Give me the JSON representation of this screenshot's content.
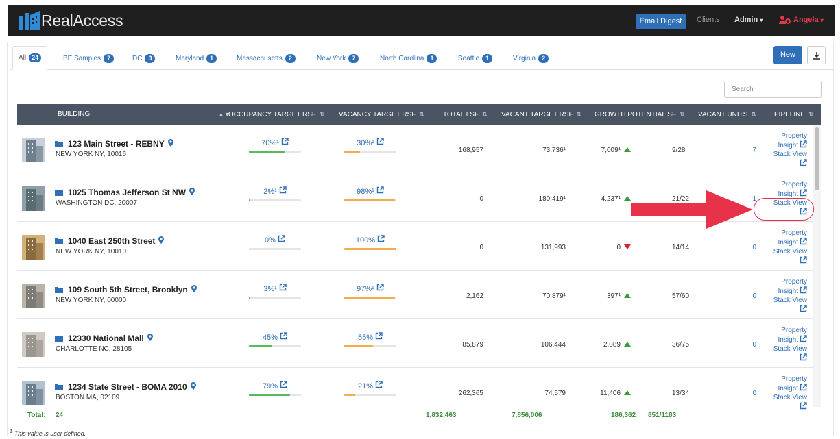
{
  "app": {
    "brand": "RealAccess",
    "nav": {
      "email_digest": "Email Digest",
      "clients": "Clients",
      "admin": "Admin",
      "user": "Angela"
    }
  },
  "tabs": [
    {
      "label": "All",
      "count": "24"
    },
    {
      "label": "BE Samples",
      "count": "7"
    },
    {
      "label": "DC",
      "count": "3"
    },
    {
      "label": "Maryland",
      "count": "1"
    },
    {
      "label": "Massachusetts",
      "count": "2"
    },
    {
      "label": "New York",
      "count": "7"
    },
    {
      "label": "North Carolina",
      "count": "1"
    },
    {
      "label": "Seattle",
      "count": "1"
    },
    {
      "label": "Virginia",
      "count": "2"
    }
  ],
  "actions": {
    "new": "New"
  },
  "search": {
    "placeholder": "Search"
  },
  "columns": {
    "building": "BUILDING",
    "occupancy": "OCCUPANCY TARGET RSF",
    "vacancy": "VACANCY TARGET RSF",
    "total_lsf": "TOTAL LSF",
    "vacant_target": "VACANT TARGET RSF",
    "growth": "GROWTH POTENTIAL SF",
    "vacant_units": "VACANT UNITS",
    "pipeline": "PIPELINE"
  },
  "pipeline_links": {
    "property_insight_1": "Property",
    "property_insight_2": "Insight",
    "stack_view": "Stack View"
  },
  "rows": [
    {
      "name": "123 Main Street - REBNY",
      "address": "NEW YORK NY, 10016",
      "occ_label": "70%¹",
      "occ": 0.7,
      "vac_label": "30%¹",
      "vac": 0.3,
      "total_lsf": "168,957",
      "vacant_target": "73,736¹",
      "growth": "7,009¹",
      "growth_dir": "up",
      "units": "9/28",
      "vacant_units": "7"
    },
    {
      "name": "1025 Thomas Jefferson St NW",
      "address": "WASHINGTON DC, 20007",
      "occ_label": "2%¹",
      "occ": 0.02,
      "vac_label": "98%¹",
      "vac": 0.98,
      "total_lsf": "0",
      "vacant_target": "180,419¹",
      "growth": "4,237¹",
      "growth_dir": "up",
      "units": "21/22",
      "vacant_units": "1"
    },
    {
      "name": "1040 East 250th Street",
      "address": "NEW YORK NY, 10010",
      "occ_label": "0%",
      "occ": 0.0,
      "vac_label": "100%",
      "vac": 1.0,
      "total_lsf": "0",
      "vacant_target": "131,993",
      "growth": "0",
      "growth_dir": "down",
      "units": "14/14",
      "vacant_units": "0"
    },
    {
      "name": "109 South 5th Street, Brooklyn",
      "address": "NEW YORK NY, 00000",
      "occ_label": "3%¹",
      "occ": 0.03,
      "vac_label": "97%¹",
      "vac": 0.97,
      "total_lsf": "2,162",
      "vacant_target": "70,879¹",
      "growth": "397¹",
      "growth_dir": "up",
      "units": "57/60",
      "vacant_units": "0"
    },
    {
      "name": "12330 National Mall",
      "address": "CHARLOTTE NC, 28105",
      "occ_label": "45%",
      "occ": 0.45,
      "vac_label": "55%",
      "vac": 0.55,
      "total_lsf": "85,879",
      "vacant_target": "106,444",
      "growth": "2,089",
      "growth_dir": "up",
      "units": "36/75",
      "vacant_units": "0"
    },
    {
      "name": "1234 State Street - BOMA 2010",
      "address": "BOSTON MA, 02109",
      "occ_label": "79%",
      "occ": 0.79,
      "vac_label": "21%",
      "vac": 0.21,
      "total_lsf": "262,365",
      "vacant_target": "74,579",
      "growth": "11,406",
      "growth_dir": "up",
      "units": "13/34",
      "vacant_units": "0"
    }
  ],
  "totals": {
    "label": "Total:",
    "count": "24",
    "total_lsf": "1,832,463",
    "vacant_target": "7,856,006",
    "growth": "186,362",
    "units": "851/1183"
  },
  "footnote": "This value is user defined.",
  "colors": {
    "accent": "#2e6fb7",
    "header": "#4a5462",
    "occupancy": "#5cb85c",
    "vacancy": "#f0ad4e",
    "total": "#3c8c3c",
    "annotation": "#e8324a"
  }
}
